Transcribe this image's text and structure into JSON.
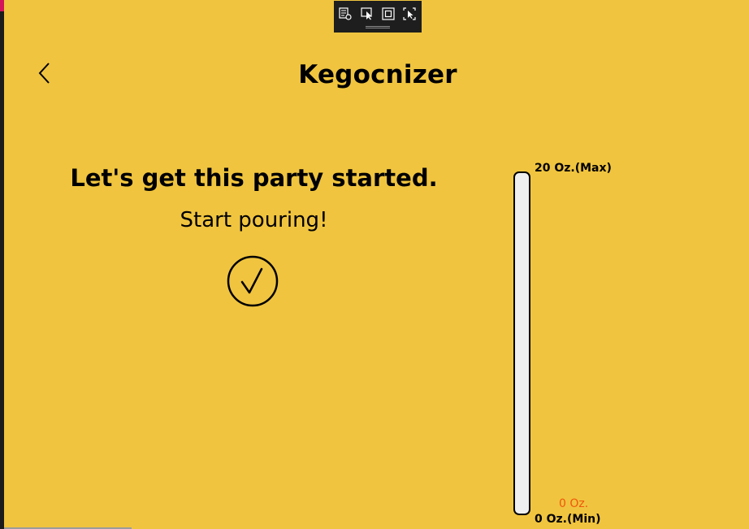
{
  "app": {
    "title": "Kegocnizer"
  },
  "header": {
    "back_icon": "chevron-left-icon"
  },
  "main": {
    "headline": "Let's get this party started.",
    "subhead": "Start pouring!",
    "status_icon": "circle-check-icon"
  },
  "gauge": {
    "max_label": "20 Oz.(Max)",
    "min_label": "0 Oz.(Min)",
    "current_label": "0 Oz.",
    "current_value": 0,
    "max_value": 20,
    "fill_color": "#f07c14",
    "current_label_color": "#f0580a"
  },
  "debug_toolbar": {
    "tools": [
      "live-visual-tree-icon",
      "select-element-icon",
      "display-layout-adorners-icon",
      "track-focus-icon"
    ]
  },
  "colors": {
    "background": "#f0c43f",
    "track": "#efefef"
  }
}
